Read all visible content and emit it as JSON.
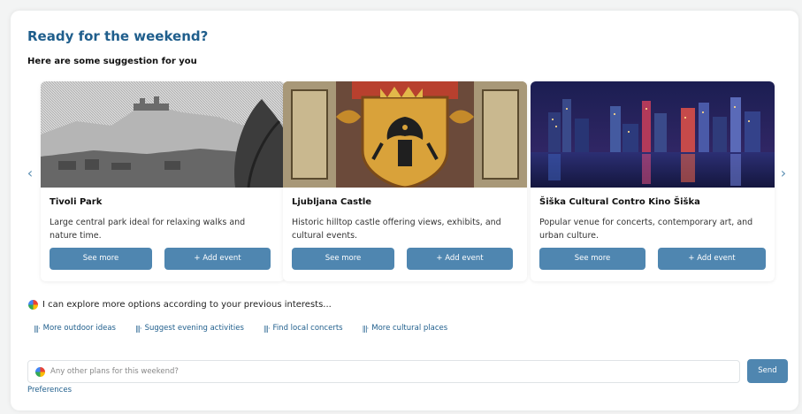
{
  "header": {
    "title": "Ready for the weekend?",
    "subtitle": "Here are some suggestion for you"
  },
  "carousel": {
    "prev_icon": "chevron-left-icon",
    "next_icon": "chevron-right-icon",
    "prev_glyph": "‹",
    "next_glyph": "›",
    "cards": [
      {
        "name": "Tivoli Park",
        "description": "Large central park ideal for relaxing walks and nature time.",
        "see_more_label": "See more",
        "add_event_label": "+ Add event"
      },
      {
        "name": "Ljubljana Castle",
        "description": "Historic hilltop castle offering views, exhibits, and cultural events.",
        "see_more_label": "See more",
        "add_event_label": "+ Add event"
      },
      {
        "name": "Šiška Cultural Contro Kino Šiška",
        "description": "Popular venue for concerts, contemporary art, and urban culture.",
        "see_more_label": "See more",
        "add_event_label": "+ Add event"
      }
    ]
  },
  "assistant": {
    "message": "I can explore more options according to your previous interests...",
    "suggestions": [
      "More outdoor ideas",
      "Suggest evening activities",
      "Find local concerts",
      "More cultural places"
    ]
  },
  "composer": {
    "placeholder": "Any other plans for this weekend?",
    "send_label": "Send",
    "preferences_label": "Preferences"
  },
  "colors": {
    "accent": "#4f86b0",
    "title": "#1f5e8c"
  }
}
